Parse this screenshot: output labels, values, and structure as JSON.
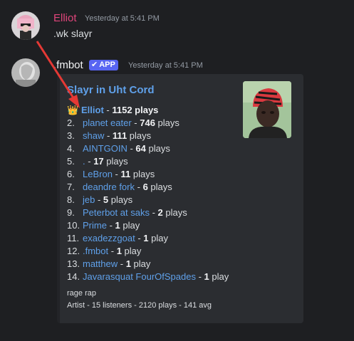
{
  "messages": [
    {
      "username": "Elliot",
      "username_color": "#e0457b",
      "timestamp": "Yesterday at 5:41 PM",
      "content": ".wk slayr"
    },
    {
      "username": ".fmbot",
      "username_color": "#f2f3f5",
      "badge": "APP",
      "timestamp": "Yesterday at 5:41 PM",
      "embed": {
        "title": "Slayr in Uht Cord",
        "rows": [
          {
            "num": "",
            "name": "Elliot",
            "plays": "1152",
            "suffix": " plays"
          },
          {
            "num": "2.",
            "name": "planet eater",
            "plays": "746",
            "suffix": " plays"
          },
          {
            "num": "3.",
            "name": "shaw",
            "plays": "111",
            "suffix": " plays"
          },
          {
            "num": "4.",
            "name": "AINTGOIN",
            "plays": "64",
            "suffix": " plays"
          },
          {
            "num": "5.",
            "name": ".",
            "plays": "17",
            "suffix": " plays"
          },
          {
            "num": "6.",
            "name": "LeBron",
            "plays": "11",
            "suffix": " plays"
          },
          {
            "num": "7.",
            "name": "deandre fork",
            "plays": "6",
            "suffix": " plays"
          },
          {
            "num": "8.",
            "name": "jeb",
            "plays": "5",
            "suffix": " plays"
          },
          {
            "num": "9.",
            "name": "Peterbot at saks",
            "plays": "2",
            "suffix": " plays"
          },
          {
            "num": "10.",
            "name": "Prime",
            "plays": "1",
            "suffix": " play"
          },
          {
            "num": "11.",
            "name": "exadezzgoat",
            "plays": "1",
            "suffix": " play"
          },
          {
            "num": "12.",
            "name": ".fmbot",
            "plays": "1",
            "suffix": " play"
          },
          {
            "num": "13.",
            "name": "matthew",
            "plays": "1",
            "suffix": " play"
          },
          {
            "num": "14.",
            "name": "Javarasquat FourOfSpades",
            "plays": "1",
            "suffix": " play"
          }
        ],
        "footer_genre": "rage rap",
        "footer_stats": "Artist - 15 listeners - 2120 plays - 141 avg"
      }
    }
  ],
  "colors": {
    "background": "#1e1f22",
    "embed_bg": "#2b2d31",
    "link": "#5fa0e9",
    "app_badge": "#5865f2",
    "arrow": "#e53935"
  },
  "icons": {
    "first_place": "crown-icon",
    "badge_check": "checkmark-icon"
  }
}
